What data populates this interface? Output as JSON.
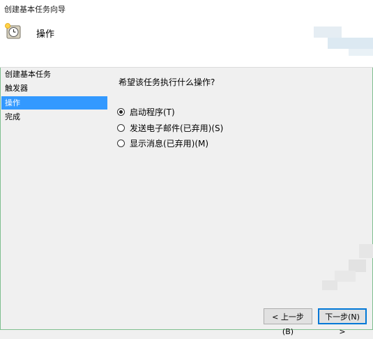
{
  "window": {
    "title": "创建基本任务向导"
  },
  "header": {
    "title": "操作",
    "icon": "clock-icon"
  },
  "sidebar": {
    "items": [
      {
        "label": "创建基本任务",
        "selected": false
      },
      {
        "label": "触发器",
        "selected": false
      },
      {
        "label": "操作",
        "selected": true
      },
      {
        "label": "完成",
        "selected": false
      }
    ]
  },
  "main": {
    "question": "希望该任务执行什么操作?",
    "options": [
      {
        "label": "启动程序(T)",
        "checked": true
      },
      {
        "label": "发送电子邮件(已弃用)(S)",
        "checked": false
      },
      {
        "label": "显示消息(已弃用)(M)",
        "checked": false
      }
    ]
  },
  "footer": {
    "back_label": "< 上一步(B)",
    "next_label": "下一步(N) >"
  },
  "colors": {
    "selection": "#3399ff",
    "frame": "#7fbf8f",
    "primary_border": "#0078d7"
  }
}
